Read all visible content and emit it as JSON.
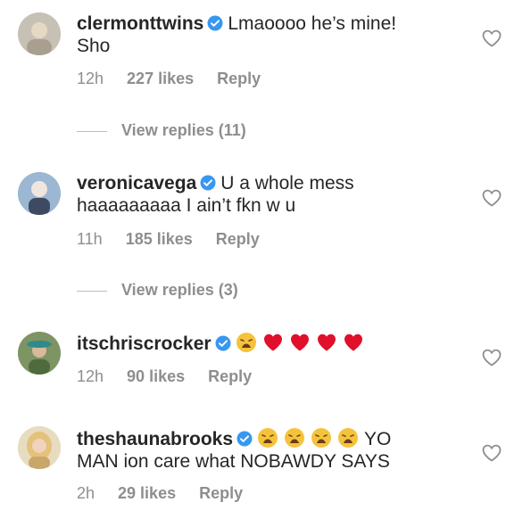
{
  "comments": [
    {
      "username": "clermonttwins",
      "text_line1": "Lmaoooo he’s mine!",
      "text_line2": "Sho",
      "time": "12h",
      "likes": "227 likes",
      "reply": "Reply",
      "view_replies": "View replies (11)",
      "avatar_color": "#b9b3a8"
    },
    {
      "username": "veronicavega",
      "text_line1": "U a whole mess",
      "text_line2": "haaaaaaaaa I ain’t fkn w u",
      "time": "11h",
      "likes": "185 likes",
      "reply": "Reply",
      "view_replies": "View replies (3)",
      "avatar_color": "#8aa6c4"
    },
    {
      "username": "itschriscrocker",
      "emojis": [
        "weary-face",
        "red-heart",
        "red-heart",
        "red-heart",
        "red-heart"
      ],
      "time": "12h",
      "likes": "90 likes",
      "reply": "Reply",
      "avatar_color": "#6f8a58"
    },
    {
      "username": "theshaunabrooks",
      "emojis": [
        "weary-face",
        "weary-face",
        "weary-face",
        "weary-face"
      ],
      "text_line1": "YO",
      "text_line2": "MAN ion care what NOBAWDY SAYS",
      "time": "2h",
      "likes": "29 likes",
      "reply": "Reply",
      "avatar_color": "#d9c79a"
    }
  ],
  "colors": {
    "text": "#262626",
    "meta": "#8e8e8e",
    "verified_badge": "#3897f0",
    "heart_emoji": "#e0102b",
    "weary_emoji": "#f5c33b"
  }
}
